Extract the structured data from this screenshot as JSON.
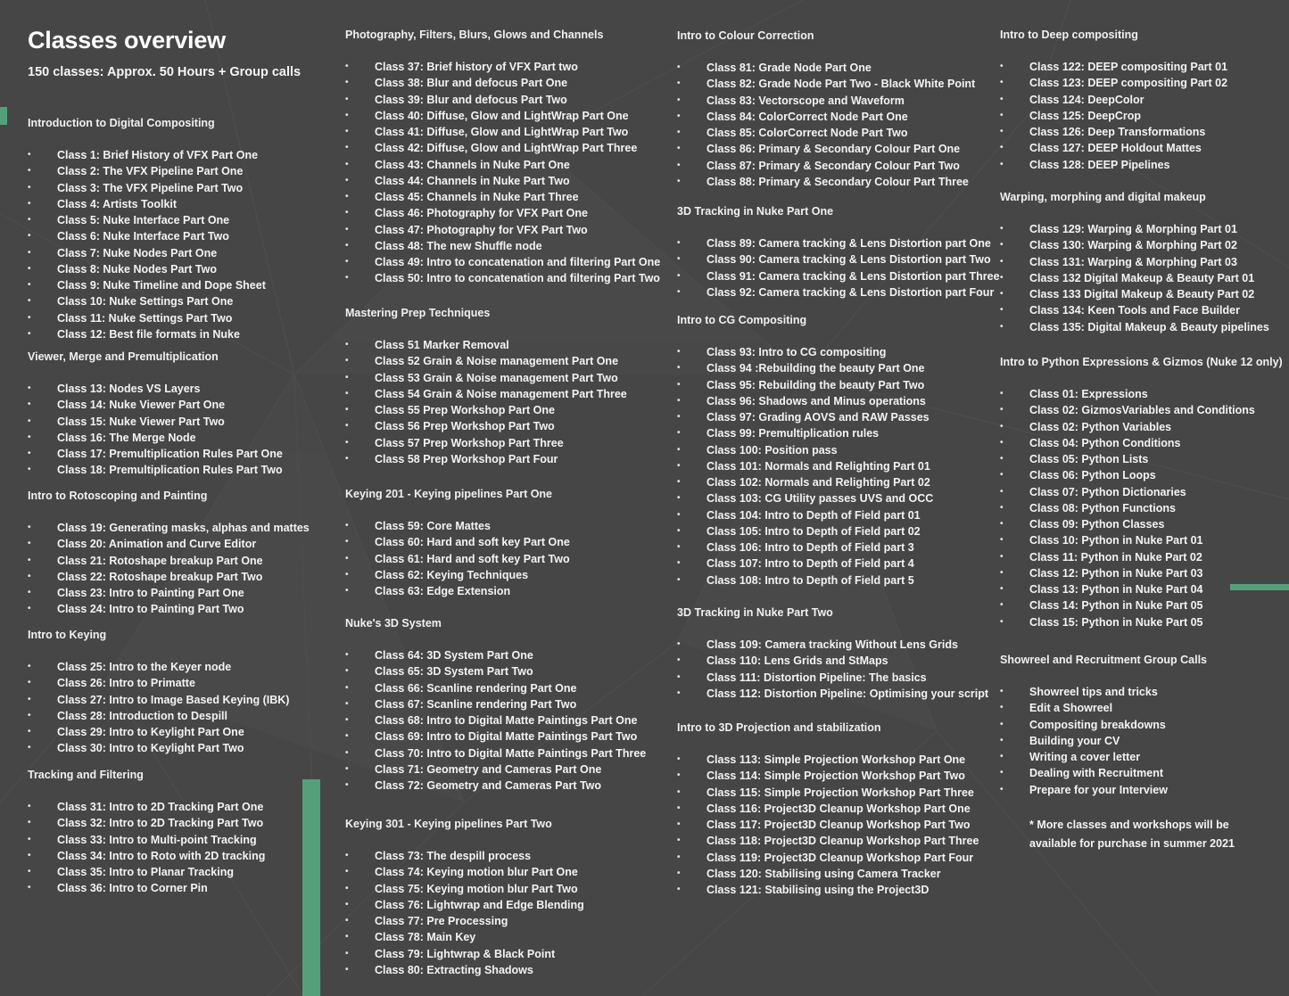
{
  "header": {
    "title": "Classes overview",
    "subtitle": "150 classes: Approx. 50 Hours + Group calls"
  },
  "colors": {
    "background": "#464646",
    "accent": "#55a07a",
    "text": "#f2f2f2"
  },
  "columns": [
    {
      "sections": [
        {
          "title": "Introduction to Digital Compositing",
          "items": [
            "Class 1: Brief History of VFX Part One",
            "Class 2: The VFX Pipeline Part One",
            "Class 3: The VFX Pipeline Part Two",
            "Class 4: Artists Toolkit",
            "Class 5: Nuke Interface Part One",
            "Class 6: Nuke Interface Part Two",
            "Class 7: Nuke Nodes Part One",
            "Class 8: Nuke Nodes Part Two",
            "Class 9: Nuke Timeline and Dope Sheet",
            "Class 10: Nuke Settings Part One",
            "Class 11: Nuke Settings Part Two",
            "Class 12: Best file formats in Nuke"
          ]
        },
        {
          "title": "Viewer, Merge and Premultiplication",
          "items": [
            "Class 13: Nodes VS Layers",
            "Class 14: Nuke Viewer Part One",
            "Class 15: Nuke Viewer Part Two",
            "Class 16: The Merge Node",
            "Class 17: Premultiplication Rules Part One",
            "Class 18: Premultiplication Rules Part Two"
          ]
        },
        {
          "title": "Intro to Rotoscoping and Painting",
          "items": [
            "Class 19: Generating masks, alphas and mattes",
            "Class 20: Animation and Curve Editor",
            "Class 21: Rotoshape breakup Part One",
            "Class 22: Rotoshape breakup Part Two",
            "Class 23: Intro to Painting Part One",
            "Class 24: Intro to Painting Part Two"
          ]
        },
        {
          "title": "Intro to Keying",
          "items": [
            "Class 25: Intro to the Keyer node",
            "Class 26: Intro to Primatte",
            "Class 27: Intro to Image Based Keying (IBK)",
            "Class 28: Introduction to Despill",
            "Class 29: Intro to Keylight Part One",
            "Class 30: Intro to Keylight Part Two"
          ]
        },
        {
          "title": "Tracking and Filtering",
          "items": [
            "Class 31: Intro to 2D Tracking Part One",
            "Class 32: Intro to 2D Tracking Part Two",
            "Class 33: Intro to Multi-point Tracking",
            "Class 34: Intro to Roto with 2D tracking",
            "Class 35: Intro to Planar Tracking",
            "Class 36: Intro to Corner Pin"
          ]
        }
      ]
    },
    {
      "sections": [
        {
          "title": "Photography, Filters, Blurs, Glows and Channels",
          "items": [
            "Class 37: Brief history of VFX Part two",
            "Class 38: Blur and defocus Part One",
            "Class 39: Blur and defocus Part Two",
            "Class 40: Diffuse, Glow and LightWrap Part One",
            "Class 41: Diffuse, Glow and LightWrap Part Two",
            "Class 42: Diffuse, Glow and LightWrap Part Three",
            "Class 43: Channels in Nuke Part One",
            "Class 44: Channels in Nuke Part Two",
            "Class 45: Channels in Nuke Part Three",
            "Class 46: Photography for VFX Part One",
            "Class 47: Photography for VFX Part Two",
            "Class 48: The new Shuffle node",
            "Class 49: Intro to concatenation and filtering Part One",
            "Class 50: Intro to concatenation and filtering Part Two"
          ]
        },
        {
          "title": "Mastering Prep Techniques",
          "items": [
            "Class 51 Marker Removal",
            "Class 52 Grain & Noise management Part One",
            "Class 53 Grain & Noise management Part Two",
            "Class 54 Grain & Noise management Part Three",
            "Class 55 Prep Workshop Part One",
            "Class 56 Prep Workshop Part Two",
            "Class 57 Prep Workshop Part Three",
            "Class 58 Prep Workshop Part Four"
          ]
        },
        {
          "title": "Keying 201 - Keying pipelines Part One",
          "items": [
            "Class 59: Core Mattes",
            "Class 60: Hard and soft key Part One",
            "Class 61: Hard and soft key Part Two",
            "Class 62: Keying Techniques",
            "Class 63: Edge Extension"
          ]
        },
        {
          "title": "Nuke's 3D System",
          "items": [
            "Class 64: 3D System Part One",
            "Class 65: 3D System Part Two",
            "Class 66: Scanline rendering Part One",
            "Class 67: Scanline rendering Part Two",
            "Class 68: Intro to Digital Matte Paintings Part One",
            "Class 69: Intro to Digital Matte Paintings Part Two",
            "Class 70: Intro to Digital Matte Paintings Part Three",
            "Class 71: Geometry and Cameras Part One",
            "Class 72: Geometry and Cameras Part Two"
          ]
        },
        {
          "title": "Keying 301 - Keying pipelines Part Two",
          "items": [
            "Class 73: The despill process",
            "Class 74: Keying motion blur Part One",
            "Class 75: Keying motion blur Part Two",
            "Class 76: Lightwrap and Edge Blending",
            "Class 77: Pre Processing",
            "Class 78: Main Key",
            "Class 79: Lightwrap & Black Point",
            "Class 80: Extracting Shadows"
          ]
        }
      ]
    },
    {
      "sections": [
        {
          "title": "Intro to Colour Correction",
          "items": [
            "Class 81: Grade Node Part One",
            "Class 82: Grade Node Part Two - Black White Point",
            "Class 83: Vectorscope and Waveform",
            "Class 84: ColorCorrect Node Part One",
            "Class 85: ColorCorrect Node Part Two",
            "Class 86: Primary & Secondary Colour Part One",
            "Class 87: Primary & Secondary Colour Part Two",
            "Class 88: Primary & Secondary Colour Part Three"
          ]
        },
        {
          "title": "3D Tracking in Nuke Part One",
          "items": [
            "Class 89: Camera tracking & Lens Distortion part One",
            "Class 90: Camera tracking & Lens Distortion part Two",
            "Class 91: Camera tracking & Lens Distortion part Three",
            "Class 92: Camera tracking & Lens Distortion part Four"
          ]
        },
        {
          "title": "Intro to CG Compositing",
          "items": [
            "Class 93: Intro to CG compositing",
            "Class 94 :Rebuilding the beauty Part One",
            "Class 95: Rebuilding the beauty Part Two",
            "Class 96: Shadows and Minus operations",
            "Class 97: Grading AOVS and RAW Passes",
            "Class 99: Premultiplication rules",
            "Class 100: Position pass",
            "Class 101: Normals and Relighting Part 01",
            "Class 102: Normals and Relighting Part 02",
            "Class 103: CG Utility passes UVS and OCC",
            "Class 104: Intro to Depth of Field part 01",
            "Class 105: Intro to Depth of Field part 02",
            "Class 106: Intro to Depth of Field part 3",
            "Class 107: Intro to Depth of Field part 4",
            "Class 108: Intro to Depth of Field part 5"
          ]
        },
        {
          "title": "3D Tracking in Nuke Part Two",
          "items": [
            "Class 109: Camera tracking Without Lens Grids",
            "Class 110: Lens Grids and StMaps",
            "Class 111: Distortion Pipeline: The basics",
            "Class 112: Distortion Pipeline: Optimising your script"
          ]
        },
        {
          "title": "Intro to  3D Projection and stabilization",
          "items": [
            "Class 113: Simple Projection Workshop Part One",
            "Class 114: Simple Projection Workshop Part Two",
            "Class 115: Simple Projection Workshop Part Three",
            "Class 116: Project3D Cleanup Workshop Part One",
            "Class 117: Project3D Cleanup Workshop Part Two",
            "Class 118: Project3D Cleanup Workshop Part Three",
            "Class 119: Project3D Cleanup Workshop Part Four",
            "Class 120: Stabilising using Camera Tracker",
            "Class 121: Stabilising using the Project3D"
          ]
        }
      ]
    },
    {
      "sections": [
        {
          "title": "Intro to Deep compositing",
          "items": [
            "Class 122: DEEP compositing Part 01",
            "Class 123: DEEP compositing Part 02",
            "Class 124: DeepColor",
            "Class 125: DeepCrop",
            "Class 126: Deep Transformations",
            "Class 127: DEEP Holdout Mattes",
            "Class 128: DEEP Pipelines"
          ]
        },
        {
          "title": "Warping, morphing and digital makeup",
          "items": [
            "Class 129: Warping & Morphing Part 01",
            "Class 130: Warping & Morphing Part 02",
            "Class 131: Warping & Morphing Part 03",
            "Class 132 Digital Makeup & Beauty Part 01",
            "Class 133 Digital Makeup & Beauty Part 02",
            "Class 134: Keen Tools and Face Builder",
            "Class 135: Digital Makeup & Beauty pipelines"
          ]
        },
        {
          "title": "Intro to Python Expressions & Gizmos (Nuke 12 only)",
          "items": [
            "Class 01: Expressions",
            "Class 02: GizmosVariables and Conditions",
            "Class 02: Python Variables",
            "Class 04: Python Conditions",
            "Class 05: Python Lists",
            "Class 06: Python Loops",
            "Class 07: Python Dictionaries",
            "Class 08: Python Functions",
            "Class 09: Python Classes",
            "Class 10: Python in Nuke Part 01",
            "Class 11: Python in Nuke Part 02",
            "Class 12: Python in Nuke Part 03",
            "Class 13: Python in Nuke Part 04",
            "Class 14: Python in Nuke Part 05",
            "Class 15: Python in Nuke Part 05"
          ]
        },
        {
          "title": "Showreel and Recruitment Group Calls",
          "items": [
            "Showreel tips and tricks",
            "Edit a Showreel",
            "Compositing breakdowns",
            "Building your CV",
            "Writing a cover letter",
            "Dealing with Recruitment",
            "Prepare for your Interview"
          ]
        }
      ]
    }
  ],
  "footnote": {
    "line1": "* More classes and workshops will be",
    "line2": "available for purchase in summer 2021"
  }
}
